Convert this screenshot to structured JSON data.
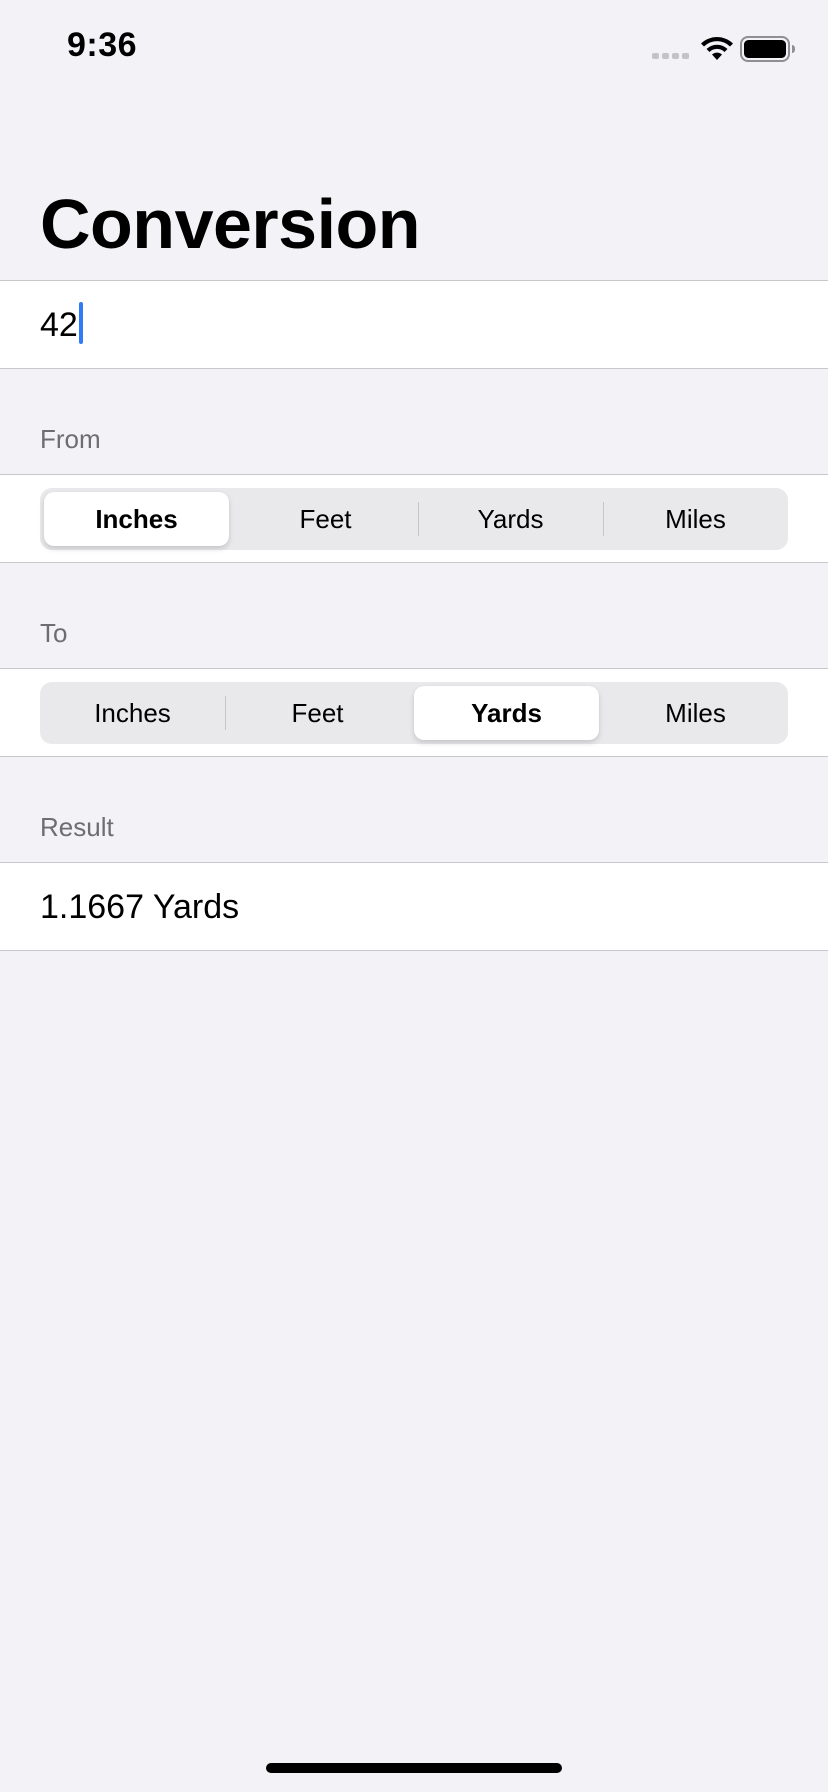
{
  "status_bar": {
    "time": "9:36",
    "icons": [
      "signal-icon",
      "wifi-icon",
      "battery-icon"
    ]
  },
  "title": "Conversion",
  "amount": {
    "value": "42"
  },
  "from": {
    "header": "From",
    "options": [
      "Inches",
      "Feet",
      "Yards",
      "Miles"
    ],
    "selected": "Inches"
  },
  "to": {
    "header": "To",
    "options": [
      "Inches",
      "Feet",
      "Yards",
      "Miles"
    ],
    "selected": "Yards"
  },
  "result": {
    "header": "Result",
    "value": "1.1667 Yards"
  },
  "colors": {
    "background": "#f2f2f7",
    "cell": "#ffffff",
    "accent": "#2f7cf6",
    "secondary_text": "#6d6d72"
  }
}
